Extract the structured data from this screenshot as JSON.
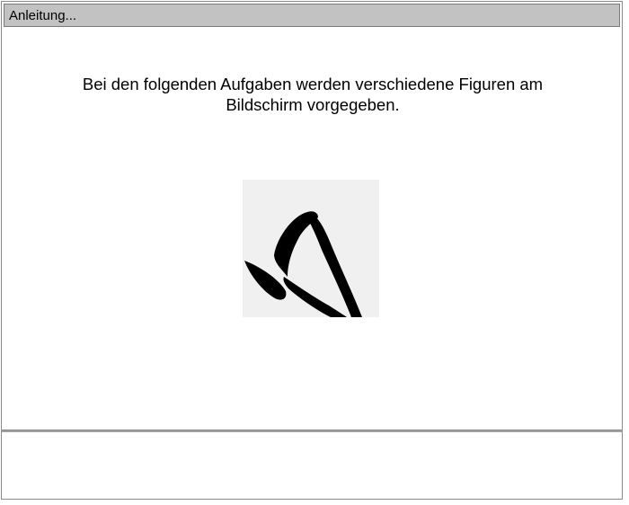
{
  "window": {
    "title": "Anleitung..."
  },
  "main": {
    "instruction_line1": "Bei den folgenden Aufgaben werden verschiedene Figuren am",
    "instruction_line2": "Bildschirm vorgegeben.",
    "figure": {
      "icon": "stroke-figure-icon",
      "background_color": "#f0f0f0",
      "stroke_color": "#000000"
    }
  },
  "colors": {
    "titlebar": "#c2c2c2",
    "border": "#8a8a8a",
    "background": "#ffffff"
  }
}
